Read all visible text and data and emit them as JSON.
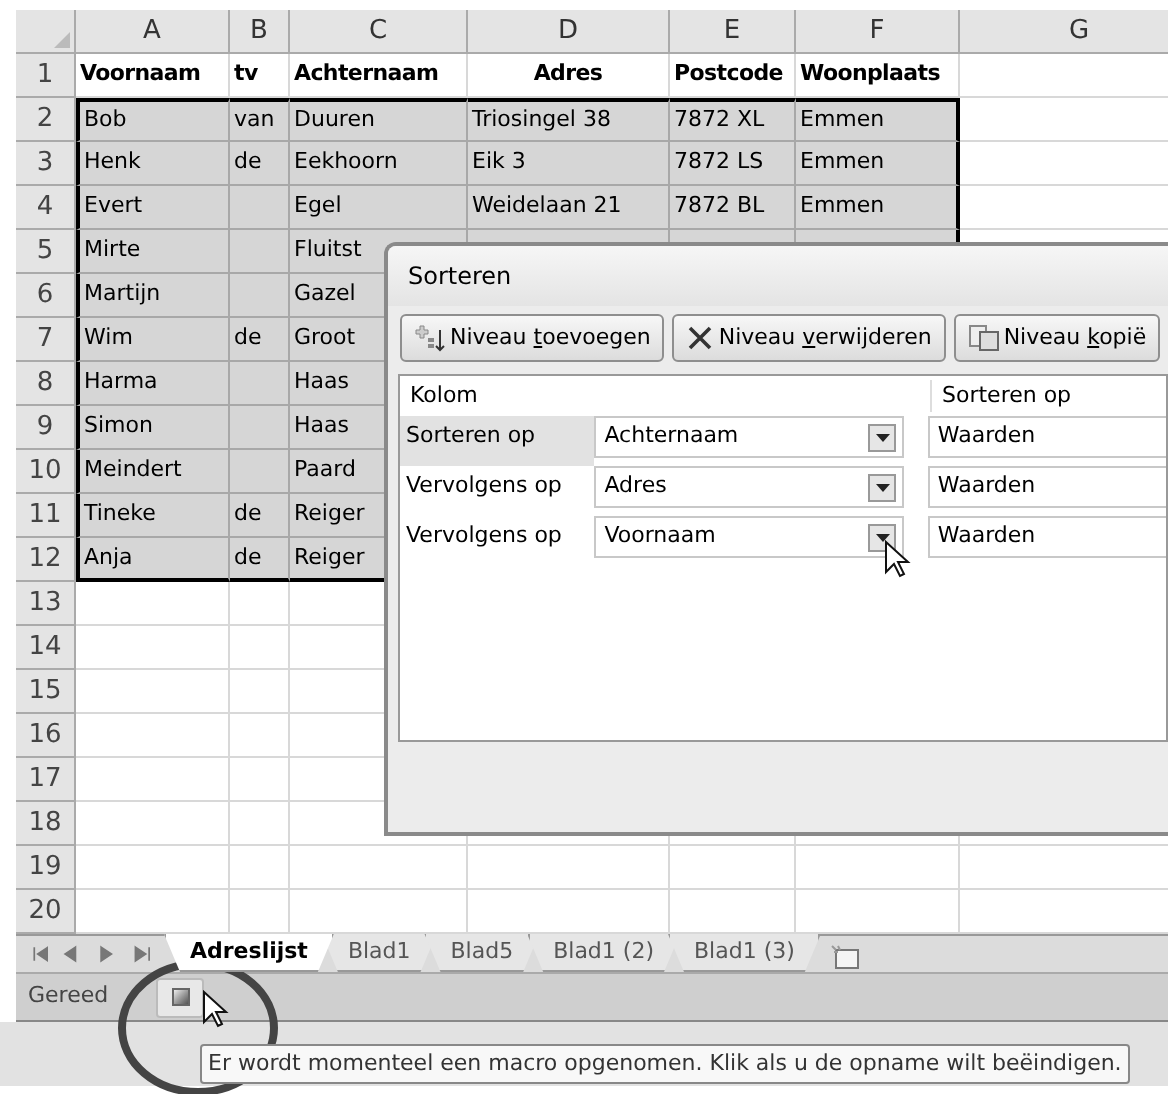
{
  "sheet": {
    "column_headers": [
      "A",
      "B",
      "C",
      "D",
      "E",
      "F",
      "G"
    ],
    "rows": [
      {
        "number": "1",
        "kind": "header",
        "selected": false,
        "cells": {
          "A": "Voornaam",
          "B": "tv",
          "C": "Achternaam",
          "D": "Adres",
          "E": "Postcode",
          "F": "Woonplaats"
        }
      },
      {
        "number": "2",
        "kind": "data",
        "selected": true,
        "cells": {
          "A": "Bob",
          "B": "van",
          "C": "Duuren",
          "D": "Triosingel 38",
          "E": "7872 XL",
          "F": "Emmen"
        }
      },
      {
        "number": "3",
        "kind": "data",
        "selected": true,
        "cells": {
          "A": "Henk",
          "B": "de",
          "C": "Eekhoorn",
          "D": "Eik 3",
          "E": "7872 LS",
          "F": "Emmen"
        }
      },
      {
        "number": "4",
        "kind": "data",
        "selected": true,
        "cells": {
          "A": "Evert",
          "C": "Egel",
          "D": "Weidelaan 21",
          "E": "7872 BL",
          "F": "Emmen"
        }
      },
      {
        "number": "5",
        "kind": "data",
        "selected": true,
        "cells": {
          "A": "Mirte",
          "C": "Fluitst"
        }
      },
      {
        "number": "6",
        "kind": "data",
        "selected": true,
        "cells": {
          "A": "Martijn",
          "C": "Gazel"
        }
      },
      {
        "number": "7",
        "kind": "data",
        "selected": true,
        "cells": {
          "A": "Wim",
          "B": "de",
          "C": "Groot"
        }
      },
      {
        "number": "8",
        "kind": "data",
        "selected": true,
        "cells": {
          "A": "Harma",
          "C": "Haas"
        }
      },
      {
        "number": "9",
        "kind": "data",
        "selected": true,
        "cells": {
          "A": "Simon",
          "C": "Haas"
        }
      },
      {
        "number": "10",
        "kind": "data",
        "selected": true,
        "cells": {
          "A": "Meindert",
          "C": "Paard"
        }
      },
      {
        "number": "11",
        "kind": "data",
        "selected": true,
        "cells": {
          "A": "Tineke",
          "B": "de",
          "C": "Reiger"
        }
      },
      {
        "number": "12",
        "kind": "data",
        "selected": true,
        "cells": {
          "A": "Anja",
          "B": "de",
          "C": "Reiger"
        }
      },
      {
        "number": "13",
        "kind": "data",
        "selected": false,
        "cells": {}
      },
      {
        "number": "14",
        "kind": "data",
        "selected": false,
        "cells": {}
      },
      {
        "number": "15",
        "kind": "data",
        "selected": false,
        "cells": {}
      },
      {
        "number": "16",
        "kind": "data",
        "selected": false,
        "cells": {}
      },
      {
        "number": "17",
        "kind": "data",
        "selected": false,
        "cells": {}
      },
      {
        "number": "18",
        "kind": "data",
        "selected": false,
        "cells": {}
      },
      {
        "number": "19",
        "kind": "data",
        "selected": false,
        "cells": {}
      },
      {
        "number": "20",
        "kind": "data",
        "selected": false,
        "cells": {}
      }
    ]
  },
  "sheet_tabs": [
    {
      "label": "Adreslijst",
      "selected": true
    },
    {
      "label": "Blad1",
      "selected": false
    },
    {
      "label": "Blad5",
      "selected": false
    },
    {
      "label": "Blad1 (2)",
      "selected": false
    },
    {
      "label": "Blad1 (3)",
      "selected": false
    }
  ],
  "status_bar": {
    "text": "Gereed"
  },
  "tooltip": {
    "text": "Er wordt momenteel een macro opgenomen. Klik als u de opname wilt beëindigen."
  },
  "dialog": {
    "title": "Sorteren",
    "buttons": [
      {
        "kind": "add",
        "before": "Niveau ",
        "access_key": "t",
        "after": "oevoegen"
      },
      {
        "kind": "delete",
        "before": "Niveau ",
        "access_key": "v",
        "after": "erwijderen"
      },
      {
        "kind": "copy",
        "before": "Niveau ",
        "access_key": "k",
        "after": "opië"
      }
    ],
    "columns": [
      "Kolom",
      "Sorteren op"
    ],
    "levels": [
      {
        "label": "Sorteren op",
        "column": "Achternaam",
        "sort_on": "Waarden",
        "selected": true
      },
      {
        "label": "Vervolgens op",
        "column": "Adres",
        "sort_on": "Waarden",
        "selected": false
      },
      {
        "label": "Vervolgens op",
        "column": "Voornaam",
        "sort_on": "Waarden",
        "selected": false
      }
    ]
  }
}
